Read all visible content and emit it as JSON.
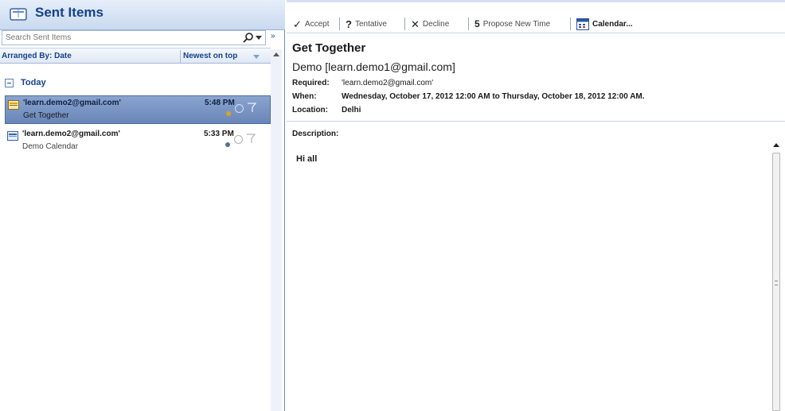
{
  "folder": {
    "title": "Sent Items",
    "search_placeholder": "Search Sent Items",
    "arranged_by": "Arranged By: Date",
    "sort_order": "Newest on top",
    "group": "Today"
  },
  "messages": [
    {
      "sender": "'learn.demo2@gmail.com'",
      "subject": "Get Together",
      "time": "5:48 PM",
      "selected": true
    },
    {
      "sender": "'learn.demo2@gmail.com'",
      "subject": "Demo Calendar",
      "time": "5:33 PM",
      "selected": false
    }
  ],
  "toolbar": {
    "accept": "Accept",
    "tentative": "Tentative",
    "decline": "Decline",
    "propose": "Propose New Time",
    "calendar": "Calendar..."
  },
  "meeting": {
    "title": "Get Together",
    "organizer": "Demo [learn.demo1@gmail.com]",
    "required_label": "Required:",
    "required_value": "'learn.demo2@gmail.com'",
    "when_label": "When:",
    "when_value": "Wednesday, October 17, 2012 12:00 AM to Thursday, October 18, 2012 12:00 AM.",
    "location_label": "Location:",
    "location_value": "Delhi",
    "description_label": "Description:",
    "body": "Hi all"
  },
  "icons": {
    "accept": "checkmark-icon",
    "tentative": "question-icon",
    "decline": "x-icon",
    "propose": "propose-time-icon",
    "calendar": "calendar-icon"
  },
  "colors": {
    "accent": "#15428b",
    "selected_row": "#7a95c4"
  }
}
